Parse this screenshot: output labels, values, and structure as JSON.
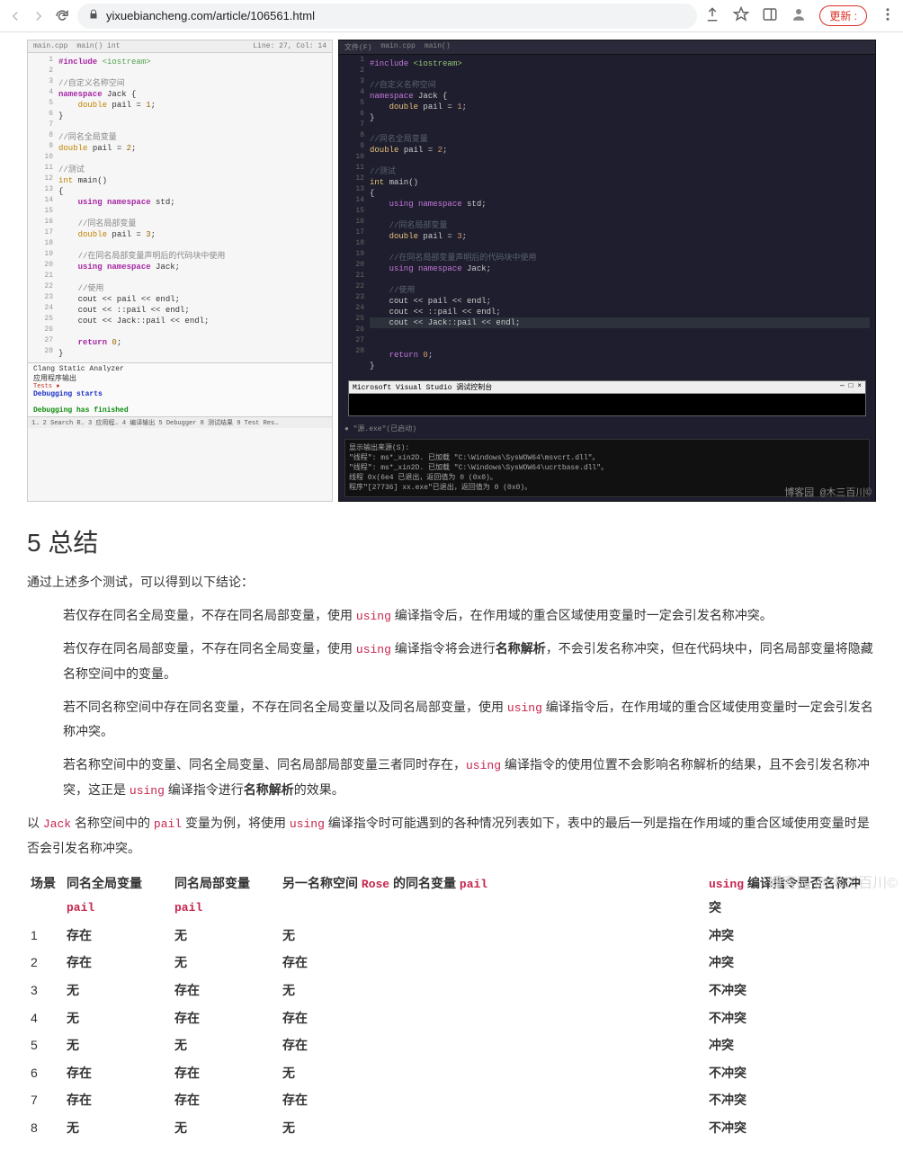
{
  "browser": {
    "url": "yixuebiancheng.com/article/106561.html",
    "update_btn": "更新 :"
  },
  "ide_light": {
    "tab1": "main.cpp",
    "tab2": "main() int",
    "status": "Line: 27, Col: 14",
    "gutter": "1\n2\n3\n4\n5\n6\n7\n8\n9\n10\n11\n12\n13\n14\n15\n16\n17\n18\n19\n20\n21\n22\n23\n24\n25\n26\n27\n28",
    "analyzer": "Clang Static Analyzer",
    "run_label": "应用程序输出",
    "dbg_start": "Debugging starts",
    "dbg_done": "Debugging has finished",
    "statusbar": "1… 2 Search R…   3 应用程…   4 编译输出   5 Debugger   8 测试结果   9 Test Res…"
  },
  "code_light": {
    "l1_a": "#include ",
    "l1_b": "<iostream>",
    "l3_cm": "//自定义名称空间",
    "l4_a": "namespace ",
    "l4_b": "Jack {",
    "l5_a": "    double ",
    "l5_b": "pail = ",
    "l5_c": "1",
    "l5_d": ";",
    "l6": "}",
    "l8_cm": "//同名全局变量",
    "l9_a": "double ",
    "l9_b": "pail = ",
    "l9_c": "2",
    "l9_d": ";",
    "l11_cm": "//测试",
    "l12_a": "int ",
    "l12_b": "main()",
    "l13": "{",
    "l14_a": "    using namespace ",
    "l14_b": "std;",
    "l16_cm": "    //同名局部变量",
    "l17_a": "    double ",
    "l17_b": "pail = ",
    "l17_c": "3",
    "l17_d": ";",
    "l19_cm": "    //在同名局部变量声明后的代码块中使用",
    "l20_a": "    using namespace ",
    "l20_b": "Jack;",
    "l22_cm": "    //使用",
    "l23": "    cout << pail << endl;",
    "l24": "    cout << ::pail << endl;",
    "l25": "    cout << Jack::pail << endl;",
    "l27_a": "    return ",
    "l27_b": "0",
    "l27_c": ";",
    "l28": "}"
  },
  "ide_dark": {
    "tab1": "文件(F)",
    "tab2": "main.cpp",
    "tab3": "main()",
    "gutter": "1\n2\n3\n4\n5\n6\n7\n8\n9\n10\n11\n12\n13\n14\n15\n16\n17\n18\n19\n20\n21\n22\n23\n24\n25\n26\n27\n28",
    "vs_title": "Microsoft Visual Studio 调试控制台",
    "out_label": "显示输出来源(S):",
    "out_line1": "\"线程\": ms*_xin2D. 已加载 \"C:\\Windows\\SysWOW64\\msvcrt.dll\"。",
    "out_line2": "\"线程\": ms*_xin2D. 已加载 \"C:\\Windows\\SysWOW64\\ucrtbase.dll\"。",
    "out_line3": "线程 0x(6e4 已退出，返回值为 0 (0x0)。",
    "out_line4": "程序\"[27736] xx.exe\"已退出，返回值为 0 (0x0)。",
    "watermark": "博客园 @木三百川©"
  },
  "article": {
    "h_section": "5 总结",
    "intro": "通过上述多个测试，可以得到以下结论：",
    "b1_a": "若仅存在同名全局变量，不存在同名局部变量，使用 ",
    "b1_code": "using",
    "b1_b": " 编译指令后，在作用域的重合区域使用变量时一定会引发名称冲突。",
    "b2_a": "若仅存在同名局部变量，不存在同名全局变量，使用 ",
    "b2_code": "using",
    "b2_b": " 编译指令将会进行",
    "b2_term": "名称解析",
    "b2_c": "，不会引发名称冲突，但在代码块中，同名局部变量将隐藏名称空间中的变量。",
    "b3_a": "若不同名称空间中存在同名变量，不存在同名全局变量以及同名局部变量，使用 ",
    "b3_code": "using",
    "b3_b": " 编译指令后，在作用域的重合区域使用变量时一定会引发名称冲突。",
    "b4_a": "若名称空间中的变量、同名全局变量、同名局部局部变量三者同时存在，",
    "b4_code1": "using",
    "b4_b": " 编译指令的使用位置不会影响名称解析的结果，且不会引发名称冲突，这正是 ",
    "b4_code2": "using",
    "b4_c": " 编译指令进行",
    "b4_term": "名称解析",
    "b4_d": "的效果。",
    "p2_a": "以 ",
    "p2_code1": "Jack",
    "p2_b": " 名称空间中的 ",
    "p2_code2": "pail",
    "p2_c": " 变量为例，将使用 ",
    "p2_code3": "using",
    "p2_d": " 编译指令时可能遇到的各种情况列表如下，表中的最后一列是指在作用域的重合区域使用变量时是否会引发名称冲突。"
  },
  "table": {
    "h1": "场景",
    "h2_a": "同名全局变量 ",
    "h2_code": "pail",
    "h3_a": "同名局部变量 ",
    "h3_code": "pail",
    "h4_a": "另一名称空间 ",
    "h4_code": "Rose",
    "h4_b": " 的同名变量 ",
    "h4_code2": "pail",
    "h5_code": "using",
    "h5_b": " 编译指令是否名称冲突",
    "rows": [
      {
        "n": "1",
        "g": "存在",
        "l": "无",
        "r": "无",
        "c": "冲突"
      },
      {
        "n": "2",
        "g": "存在",
        "l": "无",
        "r": "存在",
        "c": "冲突"
      },
      {
        "n": "3",
        "g": "无",
        "l": "存在",
        "r": "无",
        "c": "不冲突"
      },
      {
        "n": "4",
        "g": "无",
        "l": "存在",
        "r": "存在",
        "c": "不冲突"
      },
      {
        "n": "5",
        "g": "无",
        "l": "无",
        "r": "存在",
        "c": "冲突"
      },
      {
        "n": "6",
        "g": "存在",
        "l": "存在",
        "r": "无",
        "c": "不冲突"
      },
      {
        "n": "7",
        "g": "存在",
        "l": "存在",
        "r": "存在",
        "c": "不冲突"
      },
      {
        "n": "8",
        "g": "无",
        "l": "无",
        "r": "无",
        "c": "不冲突"
      }
    ]
  },
  "watermark_bottom": "博客园 @木三百川©"
}
